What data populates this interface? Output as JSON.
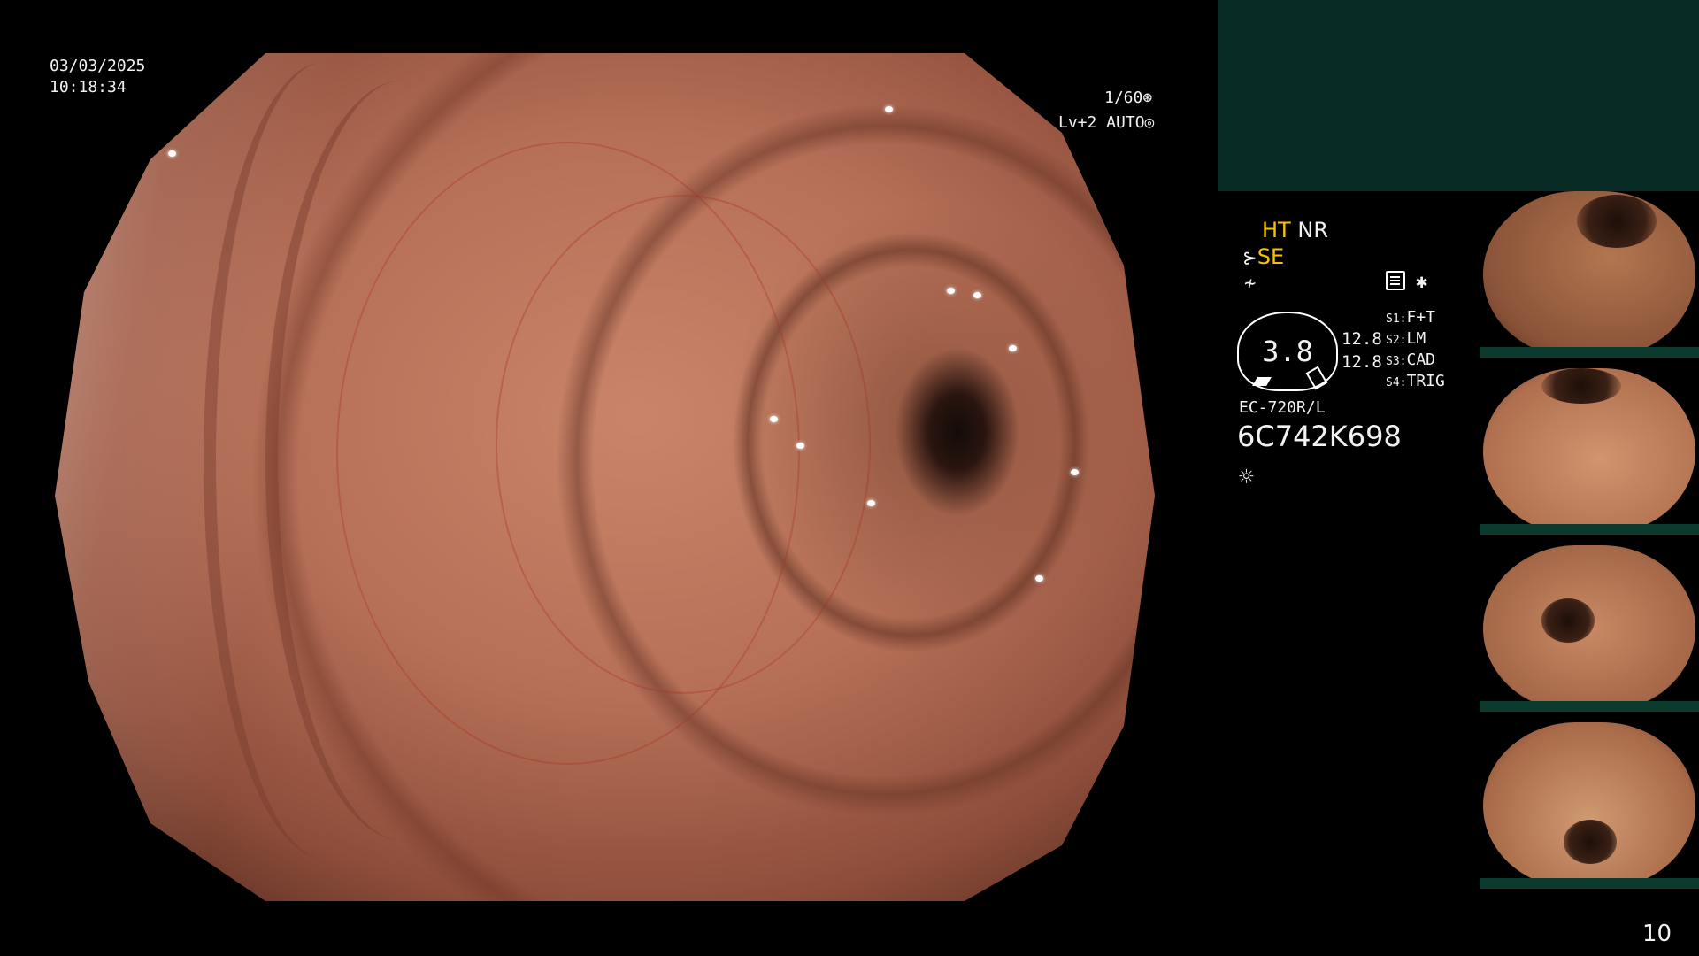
{
  "overlay": {
    "date": "03/03/2025",
    "time": "10:18:34",
    "shutter": "1/60⊛",
    "level": "Lv+2 AUTO◎"
  },
  "panel": {
    "ht": "HT",
    "nr": "NR",
    "se_icon": "⊱",
    "se": "SE",
    "sym3": "≁",
    "sym5": "✱",
    "gauge_value": "3.8",
    "num1": "12.8",
    "num2": "12.8",
    "s1_key": "S1:",
    "s1_val": "F+T",
    "s2_key": "S2:",
    "s2_val": "LM",
    "s3_key": "S3:",
    "s3_val": "CAD",
    "s4_key": "S4:",
    "s4_val": "TRIG",
    "scope_model": "EC-720R/L",
    "serial": "6C742K698",
    "sun_icon": "☼"
  },
  "page_number": "10",
  "colors": {
    "accent_yellow": "#f5c400",
    "top_right_panel": "#082b25",
    "background": "#000000"
  }
}
